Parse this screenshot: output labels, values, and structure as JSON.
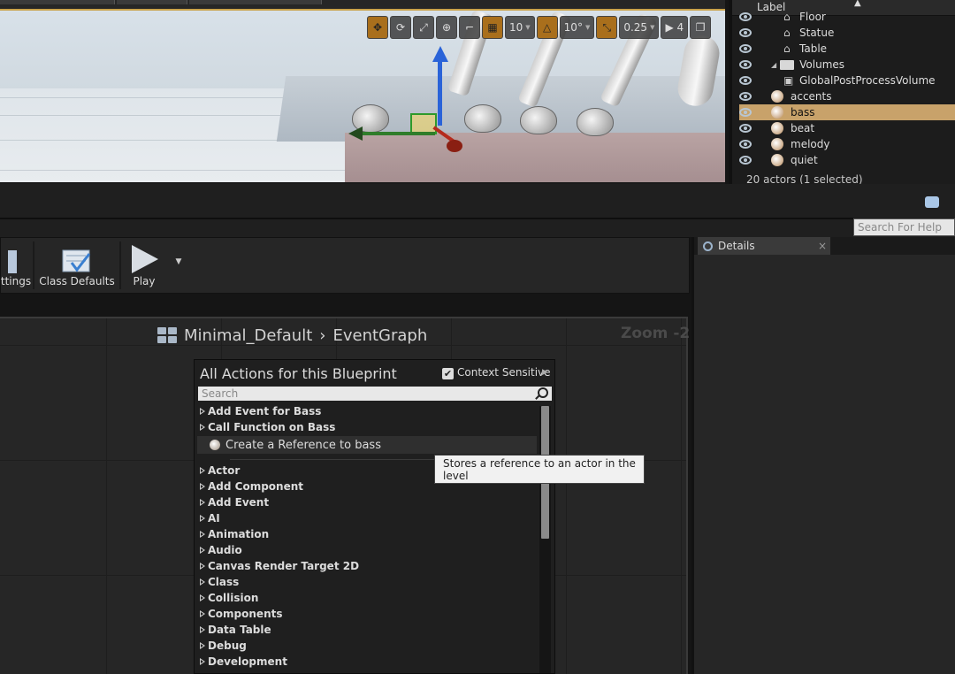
{
  "viewport": {
    "toolbar": {
      "grid_snap_value": "10",
      "rotation_snap_value": "10°",
      "scale_snap_value": "0.25",
      "camera_speed_value": "4"
    }
  },
  "outliner": {
    "header_label": "Label",
    "rows": [
      {
        "label": "Floor",
        "kind": "mesh",
        "indent": 3
      },
      {
        "label": "Statue",
        "kind": "mesh",
        "indent": 3
      },
      {
        "label": "Table",
        "kind": "mesh",
        "indent": 3
      },
      {
        "label": "Volumes",
        "kind": "folder",
        "indent": 2
      },
      {
        "label": "GlobalPostProcessVolume",
        "kind": "volume",
        "indent": 3
      },
      {
        "label": "accents",
        "kind": "actor",
        "indent": 2
      },
      {
        "label": "bass",
        "kind": "actor",
        "indent": 2,
        "selected": true
      },
      {
        "label": "beat",
        "kind": "actor",
        "indent": 2
      },
      {
        "label": "melody",
        "kind": "actor",
        "indent": 2
      },
      {
        "label": "quiet",
        "kind": "actor",
        "indent": 2
      }
    ],
    "footer": "20 actors (1 selected)"
  },
  "help": {
    "search_placeholder": "Search For Help"
  },
  "blueprint_toolbar": {
    "settings_label": "ttings",
    "class_defaults_label": "Class Defaults",
    "play_label": "Play"
  },
  "graph": {
    "breadcrumb_root": "Minimal_Default",
    "breadcrumb_sep": "›",
    "breadcrumb_current": "EventGraph",
    "zoom": "Zoom -2"
  },
  "actions_menu": {
    "title": "All Actions for this Blueprint",
    "context_sensitive_label": "Context Sensitive",
    "context_sensitive_checked": "✔",
    "search_placeholder": "Search",
    "top_items": [
      "Add Event for Bass",
      "Call Function on Bass"
    ],
    "create_ref_label": "Create a Reference to bass",
    "categories": [
      "Actor",
      "Add Component",
      "Add Event",
      "AI",
      "Animation",
      "Audio",
      "Canvas Render Target 2D",
      "Class",
      "Collision",
      "Components",
      "Data Table",
      "Debug",
      "Development"
    ]
  },
  "tooltip": {
    "text": "Stores a reference to an actor in the level"
  },
  "details": {
    "tab_label": "Details",
    "close_label": "×"
  }
}
